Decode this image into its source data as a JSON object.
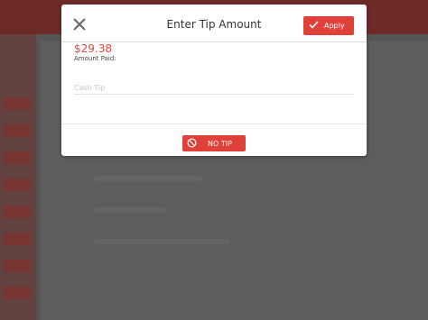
{
  "dialog": {
    "title": "Enter Tip Amount",
    "apply_label": "Apply",
    "amount_value": "$29.38",
    "amount_label": "Amount Paid:",
    "cash_tip_placeholder": "Cash Tip",
    "cash_tip_value": "",
    "no_tip_label": "NO TIP"
  },
  "colors": {
    "accent": "#e0403a",
    "amount_text": "#e4463f",
    "background_overlay": "#5f5f5f"
  },
  "icons": {
    "close": "close-icon",
    "apply": "check-icon",
    "no_tip": "ban-icon"
  }
}
